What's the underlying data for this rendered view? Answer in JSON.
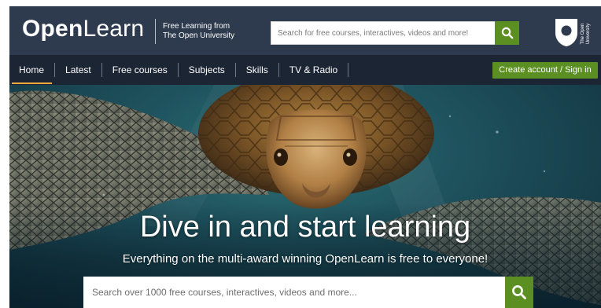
{
  "header": {
    "logo_bold": "Open",
    "logo_light": "Learn",
    "tagline_line1": "Free Learning from",
    "tagline_line2": "The Open University",
    "search_placeholder": "Search for free courses, interactives, videos and more!",
    "search_icon": "search-icon",
    "partner_logo_text": "The Open University"
  },
  "nav": {
    "items": [
      {
        "label": "Home",
        "active": true
      },
      {
        "label": "Latest",
        "active": false
      },
      {
        "label": "Free courses",
        "active": false
      },
      {
        "label": "Subjects",
        "active": false
      },
      {
        "label": "Skills",
        "active": false
      },
      {
        "label": "TV & Radio",
        "active": false
      }
    ],
    "account_button": "Create account / Sign in"
  },
  "hero": {
    "title": "Dive in and start learning",
    "subtitle": "Everything on the multi-award winning OpenLearn is free to everyone!",
    "search_placeholder": "Search over 1000 free courses, interactives, videos and more...",
    "search_icon": "search-icon"
  },
  "colors": {
    "header_bg": "#2e3b4e",
    "nav_bg": "#1c2534",
    "accent_green": "#5b8f22",
    "active_underline": "#f2a93b",
    "hero_water": "#1f5560"
  }
}
